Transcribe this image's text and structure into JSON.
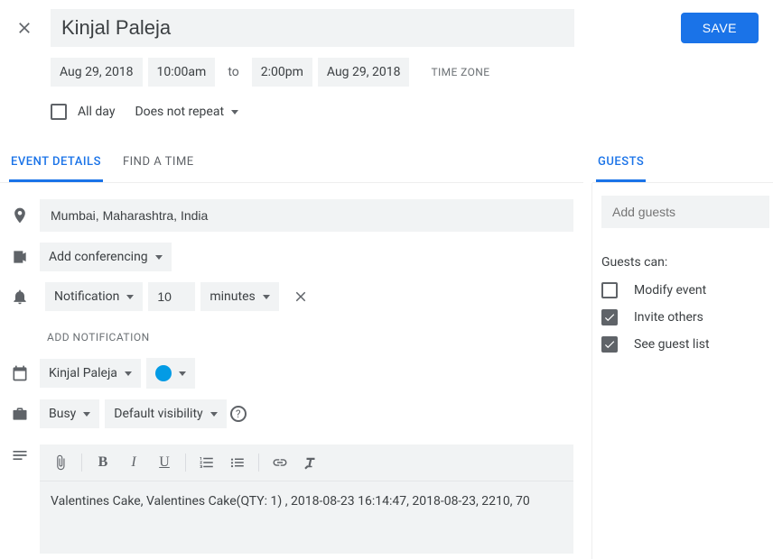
{
  "header": {
    "title_value": "Kinjal Paleja",
    "save_label": "SAVE"
  },
  "datetime": {
    "start_date": "Aug 29, 2018",
    "start_time": "10:00am",
    "to_label": "to",
    "end_time": "2:00pm",
    "end_date": "Aug 29, 2018",
    "timezone_label": "TIME ZONE"
  },
  "options": {
    "allday_label": "All day",
    "allday_checked": false,
    "recurrence": "Does not repeat"
  },
  "tabs": {
    "event_details": "EVENT DETAILS",
    "find_a_time": "FIND A TIME"
  },
  "location": {
    "value": "Mumbai, Maharashtra, India"
  },
  "conferencing": {
    "label": "Add conferencing"
  },
  "notification": {
    "type": "Notification",
    "value": "10",
    "unit": "minutes",
    "add_label": "ADD NOTIFICATION"
  },
  "calendar": {
    "owner": "Kinjal Paleja",
    "color": "#039be5"
  },
  "availability": {
    "status": "Busy",
    "visibility": "Default visibility"
  },
  "description": {
    "text": "Valentines Cake, Valentines Cake(QTY: 1) , 2018-08-23 16:14:47, 2018-08-23, 2210, 70"
  },
  "guests": {
    "tab_label": "GUESTS",
    "add_placeholder": "Add guests",
    "permissions_title": "Guests can:",
    "permissions": {
      "modify": {
        "label": "Modify event",
        "checked": false
      },
      "invite": {
        "label": "Invite others",
        "checked": true
      },
      "see_list": {
        "label": "See guest list",
        "checked": true
      }
    }
  }
}
